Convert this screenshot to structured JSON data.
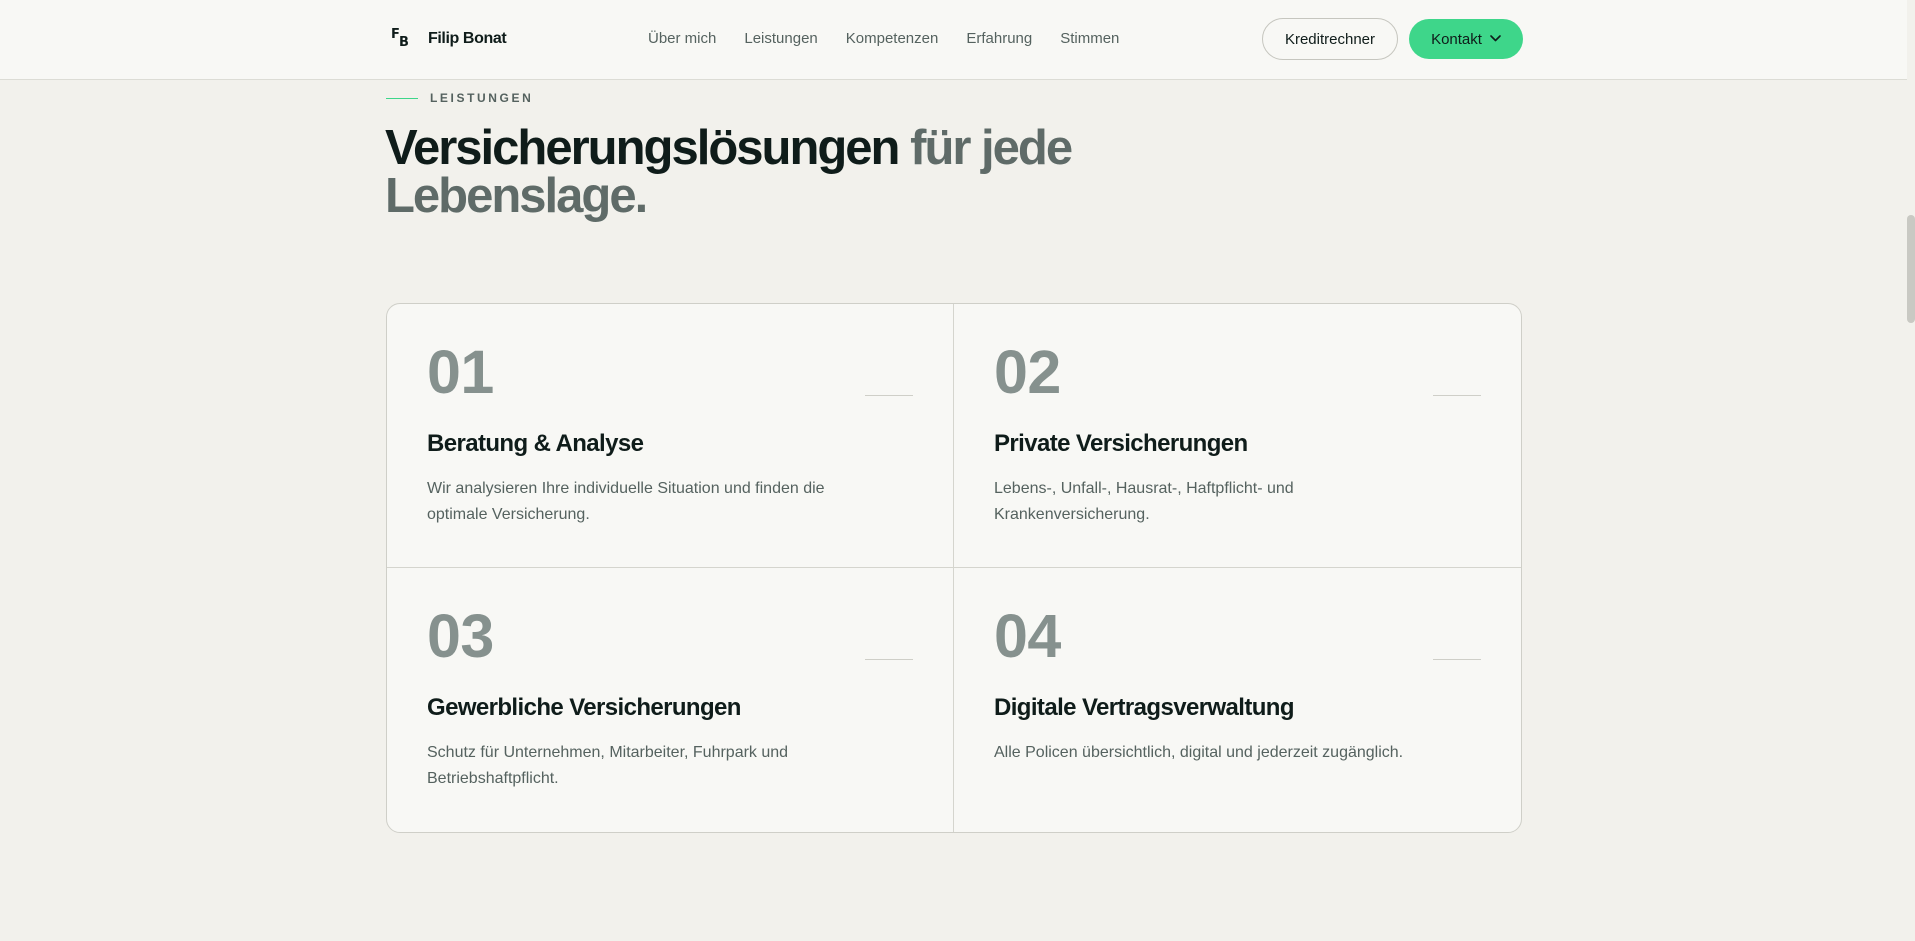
{
  "header": {
    "logo_mark_f": "F",
    "logo_mark_b": "B",
    "brand": "Filip Bonat",
    "nav": [
      "Über mich",
      "Leistungen",
      "Kompetenzen",
      "Erfahrung",
      "Stimmen"
    ],
    "calculator_label": "Kreditrechner",
    "contact_label": "Kontakt"
  },
  "section": {
    "eyebrow": "LEISTUNGEN",
    "headline_strong": "Versicherungslösungen",
    "headline_muted": "für jede Lebenslage."
  },
  "cards": [
    {
      "number": "01",
      "title": "Beratung & Analyse",
      "description": "Wir analysieren Ihre individuelle Situation und finden die optimale Versicherung."
    },
    {
      "number": "02",
      "title": "Private Versicherungen",
      "description": "Lebens-, Unfall-, Hausrat-, Haftpflicht- und Krankenversicherung."
    },
    {
      "number": "03",
      "title": "Gewerbliche Versicherungen",
      "description": "Schutz für Unternehmen, Mitarbeiter, Fuhrpark und Betriebshaftpflicht."
    },
    {
      "number": "04",
      "title": "Digitale Vertragsverwaltung",
      "description": "Alle Policen übersichtlich, digital und jederzeit zugänglich."
    }
  ],
  "colors": {
    "accent": "#3ed68a",
    "background": "#f2f1ec",
    "text": "#0f1c1a",
    "muted": "#5f6b68"
  },
  "icons": {
    "logo": "fb-monogram-icon",
    "contact_chevron": "chevron-down-icon"
  }
}
